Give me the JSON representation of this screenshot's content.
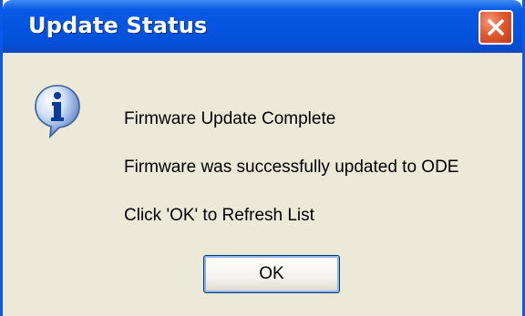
{
  "window": {
    "title": "Update Status"
  },
  "message": {
    "line1": "Firmware Update Complete",
    "line2": "Firmware was successfully updated to ODE",
    "line3": "Click 'OK' to Refresh List"
  },
  "buttons": {
    "ok_label": "OK"
  },
  "icons": {
    "dialog_icon": "information-icon",
    "close_icon": "close-icon"
  },
  "colors": {
    "titlebar": "#0554e0",
    "close_button": "#e05a32",
    "client_background": "#ece9d8"
  }
}
